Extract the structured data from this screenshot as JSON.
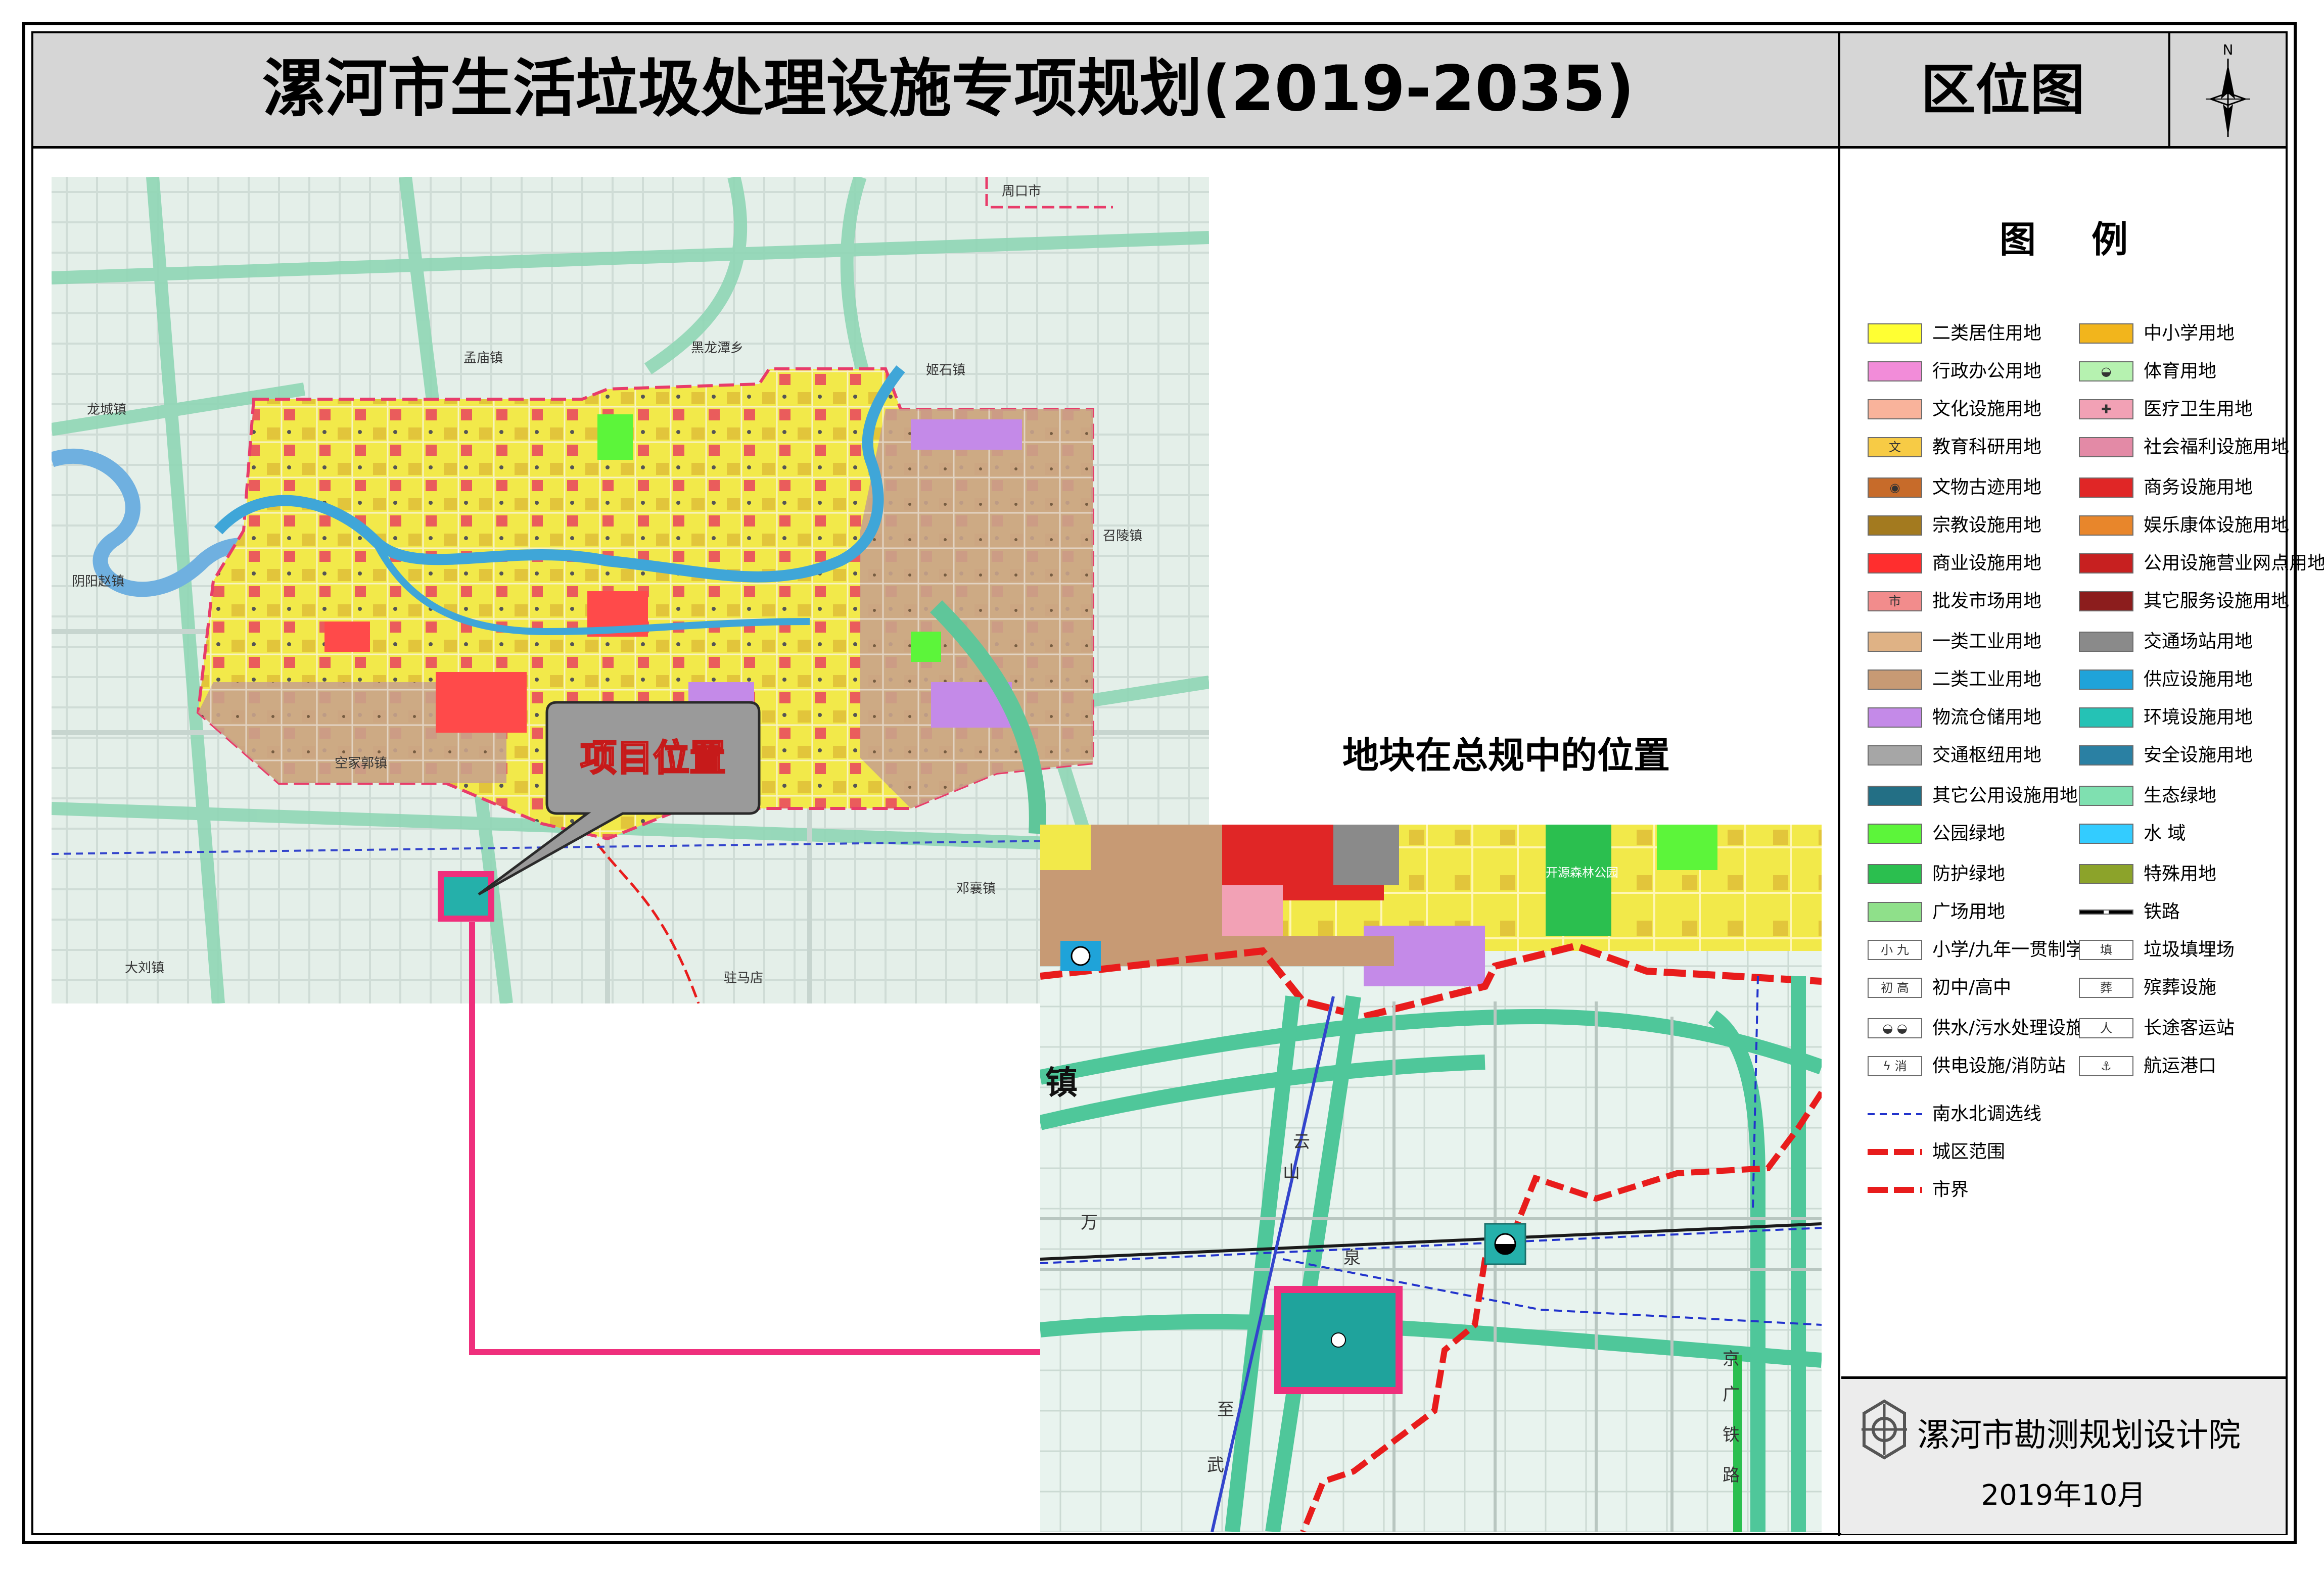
{
  "title": "漯河市生活垃圾处理设施专项规划(2019-2035)",
  "subtitle": "区位图",
  "north_label": "N",
  "callout_label": "项目位置",
  "inset_title": "地块在总规中的位置",
  "legend": {
    "heading": "图例",
    "items": [
      {
        "label": "二类居住用地",
        "color": "#ffff33",
        "glyph": ""
      },
      {
        "label": "中小学用地",
        "color": "#f2b51c",
        "glyph": ""
      },
      {
        "label": "行政办公用地",
        "color": "#f28cd9",
        "glyph": ""
      },
      {
        "label": "体育用地",
        "color": "#b6f2b0",
        "glyph": "◒"
      },
      {
        "label": "文化设施用地",
        "color": "#f9b39b",
        "glyph": ""
      },
      {
        "label": "医疗卫生用地",
        "color": "#f2a1b5",
        "glyph": "✚"
      },
      {
        "label": "教育科研用地",
        "color": "#f7cb45",
        "glyph": "文"
      },
      {
        "label": "社会福利设施用地",
        "color": "#e38aa6",
        "glyph": ""
      },
      {
        "label": "文物古迹用地",
        "color": "#c76b2a",
        "glyph": "◉"
      },
      {
        "label": "商务设施用地",
        "color": "#e02626",
        "glyph": ""
      },
      {
        "label": "宗教设施用地",
        "color": "#a37a1f",
        "glyph": ""
      },
      {
        "label": "娱乐康体设施用地",
        "color": "#e8862b",
        "glyph": ""
      },
      {
        "label": "商业设施用地",
        "color": "#ff2e2e",
        "glyph": ""
      },
      {
        "label": "公用设施营业网点用地",
        "color": "#c72020",
        "glyph": ""
      },
      {
        "label": "批发市场用地",
        "color": "#f28c8c",
        "glyph": "市"
      },
      {
        "label": "其它服务设施用地",
        "color": "#8c1d1d",
        "glyph": ""
      },
      {
        "label": "一类工业用地",
        "color": "#dfb285",
        "glyph": ""
      },
      {
        "label": "交通场站用地",
        "color": "#8a8a8a",
        "glyph": ""
      },
      {
        "label": "二类工业用地",
        "color": "#c79a74",
        "glyph": ""
      },
      {
        "label": "供应设施用地",
        "color": "#1fa3d9",
        "glyph": ""
      },
      {
        "label": "物流仓储用地",
        "color": "#c48ae8",
        "glyph": ""
      },
      {
        "label": "环境设施用地",
        "color": "#25c2b5",
        "glyph": ""
      },
      {
        "label": "交通枢纽用地",
        "color": "#a6a6a6",
        "glyph": ""
      },
      {
        "label": "安全设施用地",
        "color": "#2a80a3",
        "glyph": ""
      },
      {
        "label": "其它公用设施用地",
        "color": "#236f85",
        "glyph": ""
      },
      {
        "label": "生态绿地",
        "color": "#7fe0b0",
        "glyph": ""
      },
      {
        "label": "公园绿地",
        "color": "#5cf53a",
        "glyph": ""
      },
      {
        "label": "水 域",
        "color": "#33ccff",
        "glyph": ""
      },
      {
        "label": "防护绿地",
        "color": "#2bbf4f",
        "glyph": ""
      },
      {
        "label": "特殊用地",
        "color": "#8ca32a",
        "glyph": ""
      },
      {
        "label": "广场用地",
        "color": "#8fe08a",
        "glyph": ""
      },
      {
        "label": "铁路",
        "color": "#ffffff",
        "glyph": "rail"
      },
      {
        "label": "小学/九年一贯制学校",
        "color": "#ffffff",
        "glyph": "小 九"
      },
      {
        "label": "垃圾填埋场",
        "color": "#ffffff",
        "glyph": "填"
      },
      {
        "label": "初中/高中",
        "color": "#ffffff",
        "glyph": "初 高"
      },
      {
        "label": "殡葬设施",
        "color": "#ffffff",
        "glyph": "葬"
      },
      {
        "label": "供水/污水处理设施",
        "color": "#ffffff",
        "glyph": "◒ ◒"
      },
      {
        "label": "长途客运站",
        "color": "#ffffff",
        "glyph": "人"
      },
      {
        "label": "供电设施/消防站",
        "color": "#ffffff",
        "glyph": "ϟ 消"
      },
      {
        "label": "航运港口",
        "color": "#ffffff",
        "glyph": "⚓"
      }
    ],
    "lines": [
      {
        "label": "南水北调选线",
        "color": "#2233cc",
        "style": "dashed-thin"
      },
      {
        "label": "城区范围",
        "color": "#e81c1c",
        "style": "dashed-thick"
      },
      {
        "label": "市界",
        "color": "#e81c1c",
        "style": "dash-dot-thick"
      }
    ]
  },
  "towns": [
    "周口市",
    "孟庙镇",
    "黑龙潭乡",
    "姬石镇",
    "龙城镇",
    "召陵镇",
    "阴阳赵镇",
    "空冢郭镇",
    "邓襄镇",
    "大刘镇",
    "驻马店"
  ],
  "inset_labels": [
    "开源森林公园",
    "镇",
    "万",
    "泉",
    "云",
    "山",
    "京",
    "广",
    "铁",
    "路",
    "至",
    "武"
  ],
  "org_name": "漯河市勘测规划设计院",
  "date": "2019年10月",
  "colors": {
    "title_band": "#d6d6d6",
    "callout_link": "#ef2f7c",
    "environment_site": "#25b0aa",
    "city_boundary": "#e81c1c"
  }
}
